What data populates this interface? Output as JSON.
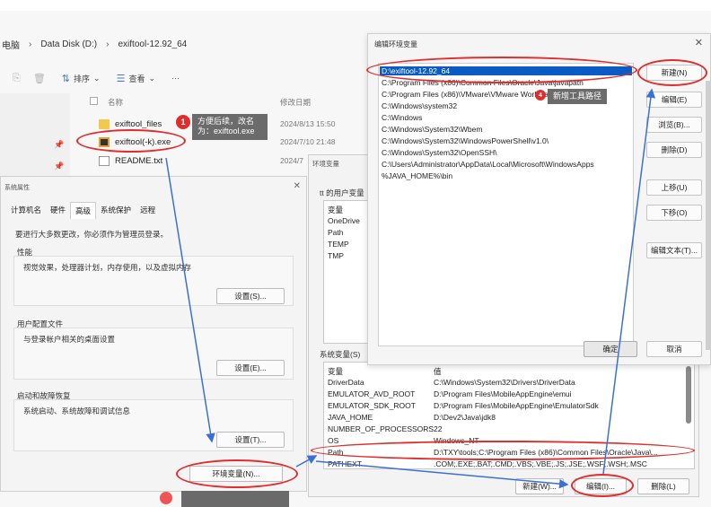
{
  "explorer": {
    "breadcrumb": [
      "电脑",
      "Data Disk (D:)",
      "exiftool-12.92_64"
    ],
    "toolbar": {
      "sort_label": "排序",
      "view_label": "查看",
      "more_label": "···"
    },
    "columns": {
      "name": "名称",
      "date": "修改日期"
    },
    "files": [
      {
        "name": "exiftool_files",
        "date": "2024/8/13 15:50",
        "type": "folder"
      },
      {
        "name": "exiftool(-k).exe",
        "date": "2024/7/10 21:48",
        "type": "exe"
      },
      {
        "name": "README.txt",
        "date": "2024/7",
        "type": "txt"
      }
    ]
  },
  "system_properties": {
    "title": "系统属性",
    "tabs": [
      "计算机名",
      "硬件",
      "高级",
      "系统保护",
      "远程"
    ],
    "active_tab": "高级",
    "admin_notice": "要进行大多数更改，你必须作为管理员登录。",
    "performance": {
      "heading": "性能",
      "desc": "视觉效果，处理器计划，内存使用，以及虚拟内存",
      "button": "设置(S)..."
    },
    "user_profiles": {
      "heading": "用户配置文件",
      "desc": "与登录帐户相关的桌面设置",
      "button": "设置(E)..."
    },
    "startup_recovery": {
      "heading": "启动和故障恢复",
      "desc": "系统启动、系统故障和调试信息",
      "button": "设置(T)..."
    },
    "env_button": "环境变量(N)..."
  },
  "environment_variables": {
    "title": "环境变量",
    "user_section_label": "tt 的用户变量",
    "user_vars": [
      "变量",
      "OneDrive",
      "Path",
      "TEMP",
      "TMP"
    ],
    "system_section_label": "系统变量(S)",
    "system_vars": [
      {
        "name": "变量",
        "value": "值"
      },
      {
        "name": "DriverData",
        "value": "C:\\Windows\\System32\\Drivers\\DriverData"
      },
      {
        "name": "EMULATOR_AVD_ROOT",
        "value": "D:\\Program Files\\MobileAppEngine\\emui"
      },
      {
        "name": "EMULATOR_SDK_ROOT",
        "value": "D:\\Program Files\\MobileAppEngine\\EmulatorSdk"
      },
      {
        "name": "JAVA_HOME",
        "value": "D:\\Dev2\\Java\\jdk8"
      },
      {
        "name": "NUMBER_OF_PROCESSORS",
        "value": "22"
      },
      {
        "name": "OS",
        "value": "Windows_NT"
      },
      {
        "name": "Path",
        "value": "D:\\TXY\\tools;C:\\Program Files (x86)\\Common Files\\Oracle\\Java\\..."
      },
      {
        "name": "PATHEXT",
        "value": ".COM;.EXE;.BAT;.CMD;.VBS;.VBE;.JS;.JSE;.WSF;.WSH;.MSC"
      }
    ],
    "buttons": {
      "new": "新建(W)...",
      "edit": "编辑(I)...",
      "delete": "删除(L)"
    }
  },
  "edit_env": {
    "title": "编辑环境变量",
    "entries": [
      "D:\\exiftool-12.92_64",
      "C:\\Program Files (x86)\\Common Files\\Oracle\\Java\\javapath",
      "C:\\Program Files (x86)\\VMware\\VMware Workstation\\bin\\",
      "C:\\Windows\\system32",
      "C:\\Windows",
      "C:\\Windows\\System32\\Wbem",
      "C:\\Windows\\System32\\WindowsPowerShell\\v1.0\\",
      "C:\\Windows\\System32\\OpenSSH\\",
      "C:\\Users\\Administrator\\AppData\\Local\\Microsoft\\WindowsApps",
      "%JAVA_HOME%\\bin"
    ],
    "selected_index": 0,
    "hidden_entry_index": 4,
    "buttons": {
      "new": "新建(N)",
      "edit": "编辑(E)",
      "browse": "浏览(B)...",
      "delete": "删除(D)",
      "up": "上移(U)",
      "down": "下移(O)",
      "edit_text": "编辑文本(T)...",
      "ok": "确定",
      "cancel": "取消"
    }
  },
  "annotations": {
    "step1": {
      "badge": "1",
      "line1": "方便后续，改名",
      "line2": "为：exiftool.exe"
    },
    "step4": {
      "badge": "4",
      "text": "新增工具路径"
    }
  },
  "colors": {
    "accent_red": "#e02d2d",
    "selection_blue": "#0a5bc4",
    "arrow_blue": "#3b6fd6",
    "tooltip_gray": "#6b6b6b"
  }
}
